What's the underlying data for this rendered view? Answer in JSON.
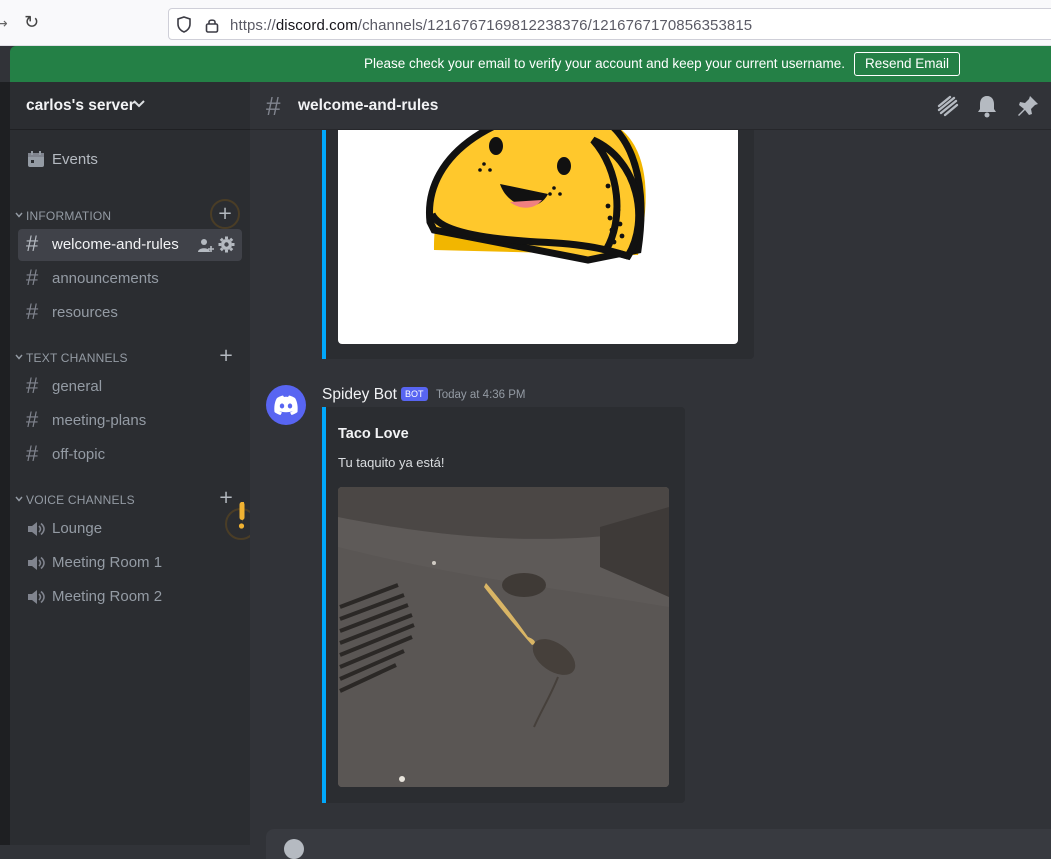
{
  "browser": {
    "url_domain": "discord.com",
    "url_prefix": "https://",
    "url_path": "/channels/1216767169812238376/1216767170856353815"
  },
  "banner": {
    "message": "Please check your email to verify your account and keep your current username.",
    "button_label": "Resend Email"
  },
  "server": {
    "name": "carlos's server"
  },
  "sidebar": {
    "events_label": "Events",
    "categories": [
      {
        "label": "INFORMATION",
        "channels": [
          "welcome-and-rules",
          "announcements",
          "resources"
        ]
      },
      {
        "label": "TEXT CHANNELS",
        "channels": [
          "general",
          "meeting-plans",
          "off-topic"
        ]
      },
      {
        "label": "VOICE CHANNELS",
        "channels": [
          "Lounge",
          "Meeting Room 1",
          "Meeting Room 2"
        ]
      }
    ],
    "active_channel": "welcome-and-rules"
  },
  "channel": {
    "hash": "#",
    "name": "welcome-and-rules"
  },
  "message": {
    "author": "Spidey Bot",
    "bot_tag": "BOT",
    "timestamp": "Today at 4:36 PM",
    "embed_title": "Taco Love",
    "embed_description": "Tu taquito ya está!"
  },
  "colors": {
    "accent": "#5865f2",
    "banner_green": "#248046",
    "embed_bar": "#00a8fc",
    "taco_yellow": "#ffc82c"
  }
}
